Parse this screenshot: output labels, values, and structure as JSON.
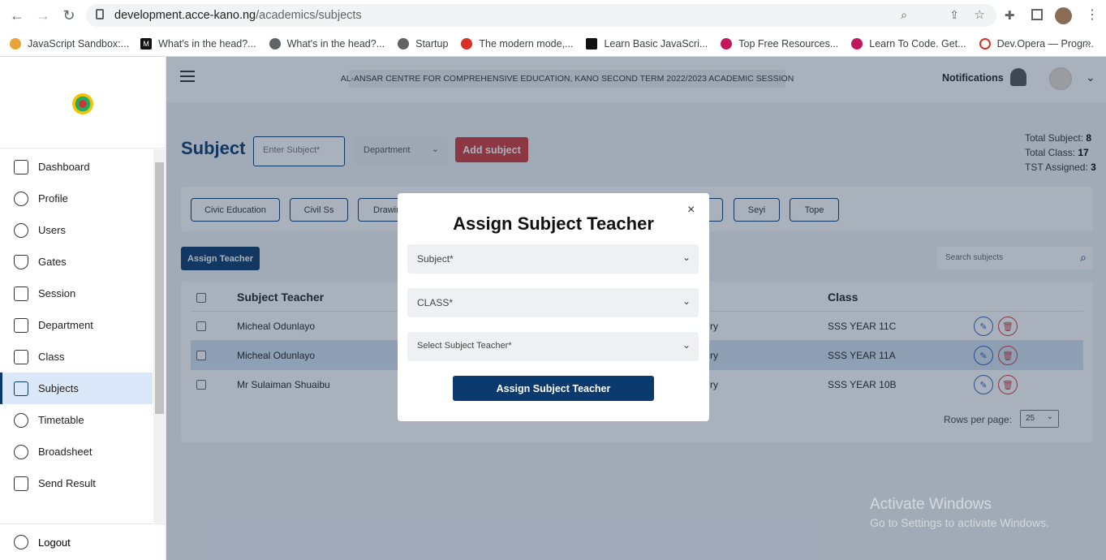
{
  "browser": {
    "url_host": "development.acce-kano.ng",
    "url_path": "/academics/subjects",
    "bookmarks": [
      "JavaScript Sandbox:...",
      "What's in the head?...",
      "What's in the head?...",
      "Startup",
      "The modern mode,...",
      "Learn Basic JavaScri...",
      "Top Free Resources...",
      "Learn To Code. Get...",
      "Dev.Opera — Progr..."
    ],
    "more": "»"
  },
  "sidebar": {
    "items": [
      {
        "label": "Dashboard",
        "icon": "dashboard-icon"
      },
      {
        "label": "Profile",
        "icon": "profile-icon"
      },
      {
        "label": "Users",
        "icon": "users-icon"
      },
      {
        "label": "Gates",
        "icon": "shield-icon"
      },
      {
        "label": "Session",
        "icon": "calendar-icon"
      },
      {
        "label": "Department",
        "icon": "building-icon"
      },
      {
        "label": "Class",
        "icon": "board-icon"
      },
      {
        "label": "Subjects",
        "icon": "book-icon"
      },
      {
        "label": "Timetable",
        "icon": "clock-icon"
      },
      {
        "label": "Broadsheet",
        "icon": "check-icon"
      },
      {
        "label": "Send Result",
        "icon": "doc-icon"
      }
    ],
    "active": "Subjects",
    "logout": "Logout"
  },
  "header": {
    "banner": "AL-ANSAR CENTRE FOR COMPREHENSIVE EDUCATION, KANO   SECOND TERM 2022/2023 ACADEMIC SESSION",
    "notifications": "Notifications"
  },
  "page": {
    "title": "Subject",
    "subject_placeholder": "Enter Subject*",
    "department_label": "Department",
    "add_button": "Add subject",
    "totals": {
      "subject_label": "Total Subject:",
      "subject_value": "8",
      "class_label": "Total Class:",
      "class_value": "17",
      "tst_label": "TST Assigned:",
      "tst_value": "3"
    },
    "chips": [
      "Civic Education",
      "Civil Ss",
      "Drawin",
      "Seyi",
      "Tope"
    ],
    "assign_button": "Assign Teacher",
    "search_placeholder": "Search subjects",
    "columns": {
      "teacher": "Subject Teacher",
      "class": "Class"
    },
    "rows": [
      {
        "teacher": "Micheal Odunlayo",
        "mid": "ry",
        "class": "SSS YEAR 11C"
      },
      {
        "teacher": "Micheal Odunlayo",
        "mid": "ry",
        "class": "SSS YEAR 11A"
      },
      {
        "teacher": "Mr Sulaiman Shuaibu",
        "mid": "ry",
        "class": "SSS YEAR 10B"
      }
    ],
    "rows_per_page_label": "Rows per page:",
    "rows_per_page": "25"
  },
  "modal": {
    "title": "Assign Subject Teacher",
    "close": "×",
    "subject_select": "Subject*",
    "class_select": "CLASS*",
    "teacher_select": "Select Subject Teacher*",
    "submit": "Assign Subject Teacher"
  },
  "windows": {
    "line1": "Activate Windows",
    "line2": "Go to Settings to activate Windows."
  }
}
